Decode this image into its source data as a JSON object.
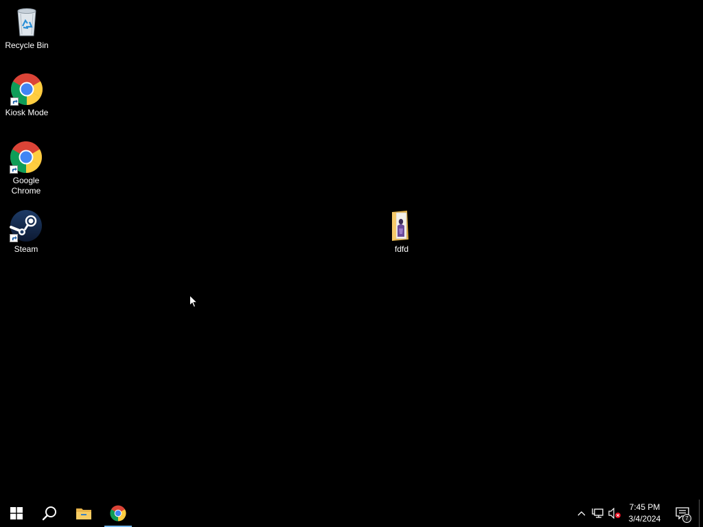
{
  "desktop": {
    "icons": [
      {
        "label": "Recycle Bin",
        "icon": "recycle-bin-icon"
      },
      {
        "label": "Kiosk Mode",
        "icon": "chrome-icon",
        "shortcut": true
      },
      {
        "label": "Google Chrome",
        "icon": "chrome-icon",
        "shortcut": true
      },
      {
        "label": "Steam",
        "icon": "steam-icon",
        "shortcut": true
      },
      {
        "label": "fdfd",
        "icon": "folder-icon"
      }
    ]
  },
  "taskbar": {
    "buttons": [
      {
        "name": "start",
        "icon": "windows-logo-icon"
      },
      {
        "name": "search",
        "icon": "search-icon"
      },
      {
        "name": "file-explorer",
        "icon": "folder-icon"
      },
      {
        "name": "google-chrome",
        "icon": "chrome-icon",
        "active": true
      }
    ],
    "tray": {
      "icons": [
        "chevron-up-icon",
        "network-icon",
        "volume-muted-icon"
      ],
      "time": "7:45 PM",
      "date": "3/4/2024",
      "notification_count": "7"
    }
  },
  "colors": {
    "background": "#000000",
    "taskbar": "#000000",
    "active_indicator": "#76b9ed",
    "windows_logo": "#ffffff"
  }
}
